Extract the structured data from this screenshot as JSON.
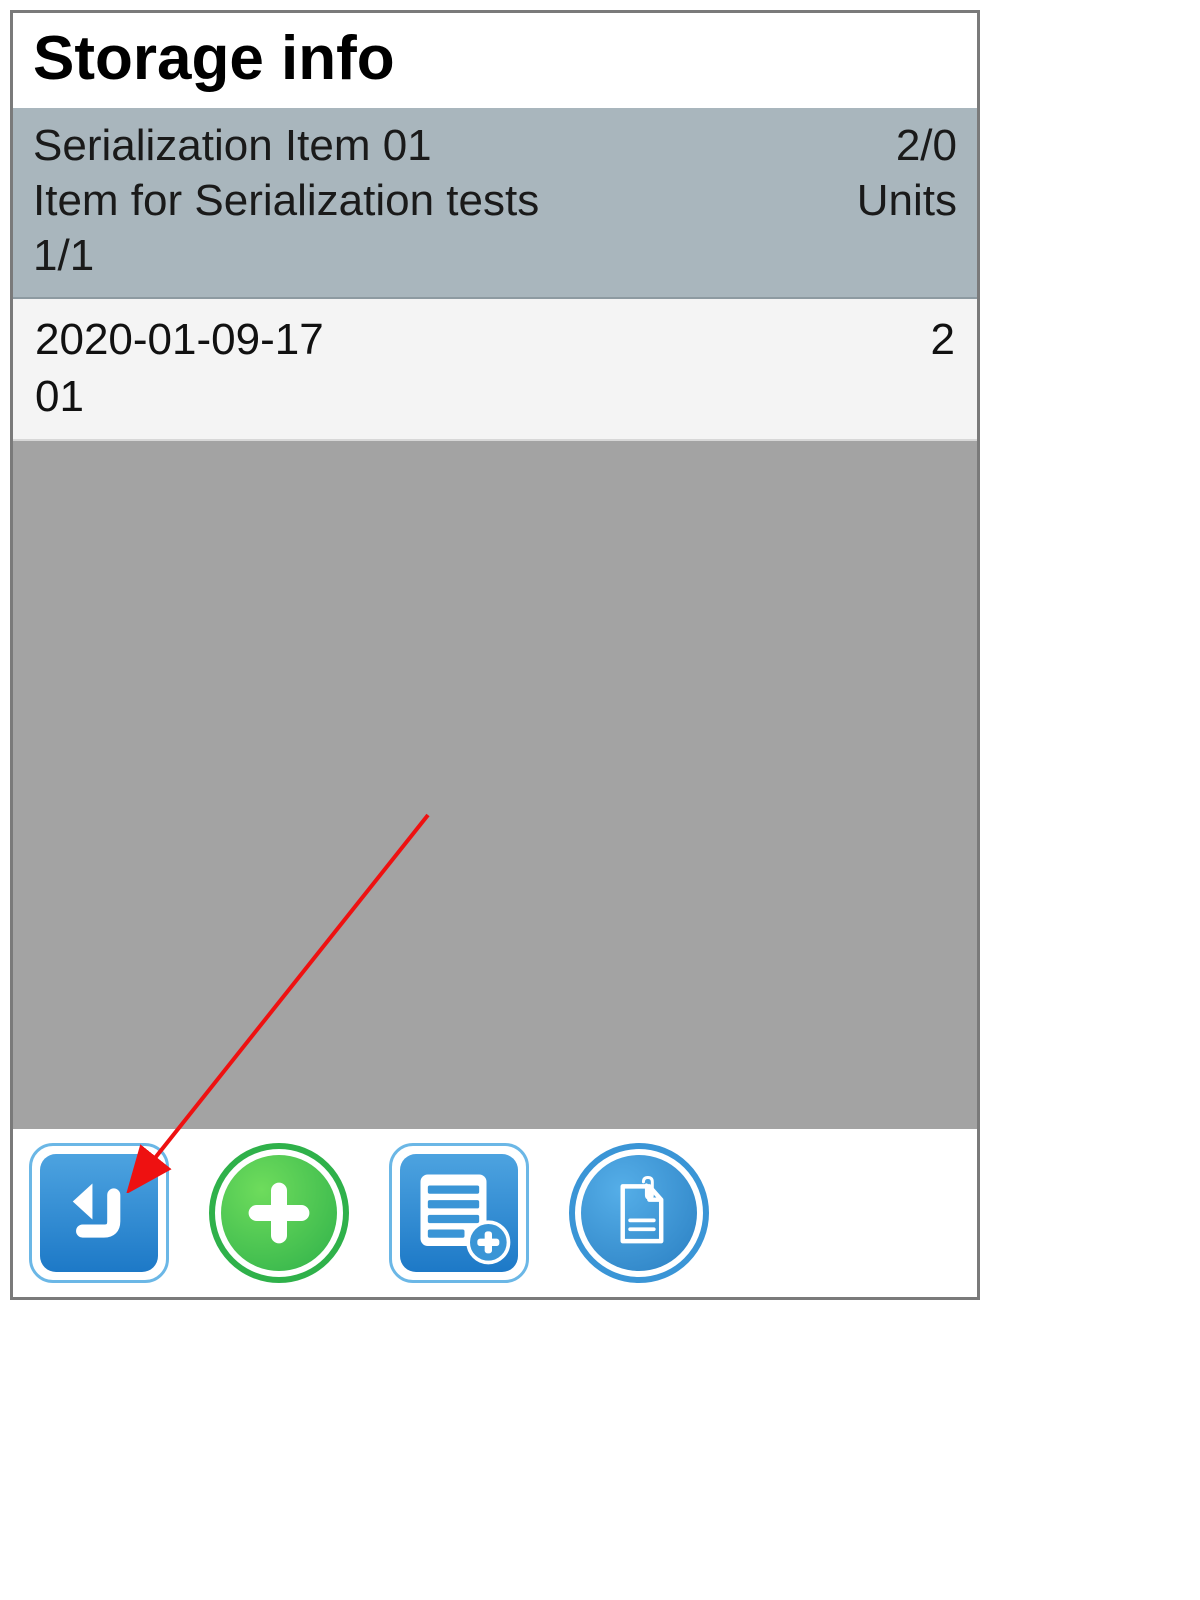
{
  "title": "Storage info",
  "header": {
    "item_code": "Serialization Item 01",
    "count": "2/0",
    "item_desc": "Item for Serialization tests",
    "unit_label": "Units",
    "position": "1/1"
  },
  "rows": [
    {
      "serial": "2020-01-09-17",
      "qty": "2",
      "sub": "01"
    }
  ],
  "toolbar": {
    "back": "back-button",
    "add": "add-button",
    "add_list": "add-list-button",
    "attachment": "attachment-button"
  }
}
